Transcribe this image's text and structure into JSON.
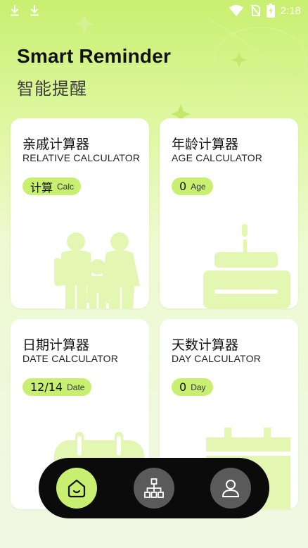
{
  "header": {
    "title": "Smart Reminder",
    "subtitle": "智能提醒"
  },
  "status_bar": {
    "time": "2:18",
    "icons": [
      "download-icon",
      "download-icon",
      "wifi-icon",
      "no-sim-icon",
      "battery-charging-icon"
    ]
  },
  "cards": [
    {
      "title": "亲戚计算器",
      "subtitle": "RELATIVE CALCULATOR",
      "value": "计算",
      "unit": "Calc",
      "art": "family-icon"
    },
    {
      "title": "年龄计算器",
      "subtitle": "AGE CALCULATOR",
      "value": "0",
      "unit": "Age",
      "art": "cake-icon"
    },
    {
      "title": "日期计算器",
      "subtitle": "DATE CALCULATOR",
      "value": "12/14",
      "unit": "Date",
      "art": "calendar-icon"
    },
    {
      "title": "天数计算器",
      "subtitle": "DAY CALCULATOR",
      "value": "0",
      "unit": "Day",
      "art": "calendar-icon"
    }
  ],
  "bottom_nav": {
    "items": [
      {
        "icon": "home-icon",
        "active": true
      },
      {
        "icon": "org-chart-icon",
        "active": false
      },
      {
        "icon": "user-icon",
        "active": false
      }
    ]
  },
  "colors": {
    "accent": "#c9ef70",
    "card": "#ffffff",
    "nav_bg": "#0b0b0b",
    "nav_inactive": "#5a5a5a",
    "illustration": "#e3f6b2"
  }
}
